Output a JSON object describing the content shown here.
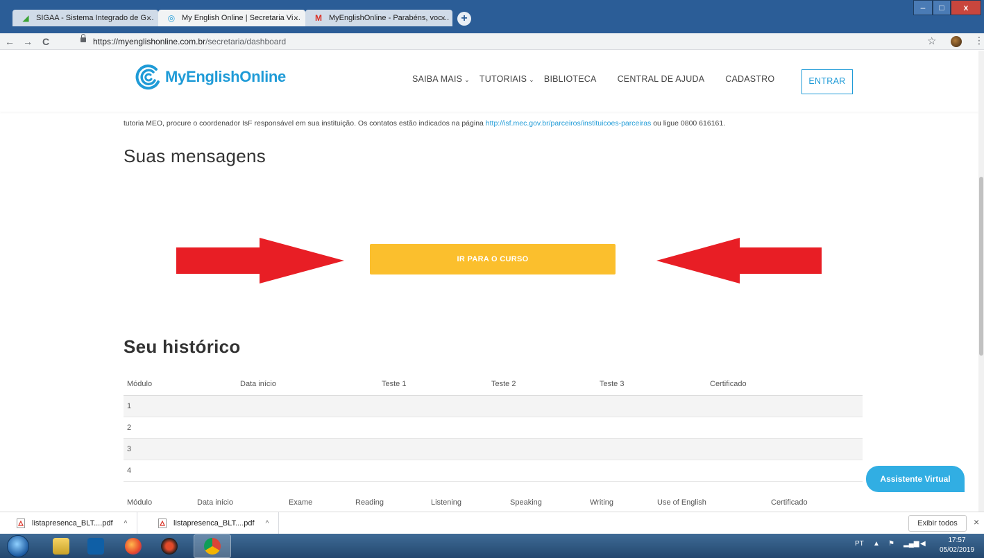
{
  "browser": {
    "tabs": [
      {
        "title": "SIGAA - Sistema Integrado de G…",
        "favicon": "sigaa-leaf-icon"
      },
      {
        "title": "My English Online | Secretaria Vi…",
        "favicon": "meo-logo-icon"
      },
      {
        "title": "MyEnglishOnline - Parabéns, voc…",
        "favicon": "gmail-icon"
      }
    ],
    "tab_close": "×",
    "new_tab": "+",
    "window_controls": {
      "minimize": "–",
      "maximize": "□",
      "close": "x"
    },
    "url_host": "https://myenglishonline.com.br",
    "url_path": "/secretaria/dashboard",
    "nav_back": "←",
    "nav_forward": "→",
    "nav_reload": "C",
    "bookmark_star": "☆",
    "menu_kebab": "⋮"
  },
  "site": {
    "logo_text": "MyEnglishOnline",
    "nav": [
      {
        "label": "SAIBA MAIS",
        "dropdown": true
      },
      {
        "label": "TUTORIAIS",
        "dropdown": true
      },
      {
        "label": "BIBLIOTECA",
        "dropdown": false
      },
      {
        "label": "CENTRAL DE AJUDA",
        "dropdown": false
      },
      {
        "label": "CADASTRO",
        "dropdown": false
      }
    ],
    "chevron": "⌄",
    "login_label": "ENTRAR",
    "accent_color": "#1f9bd7"
  },
  "intro": {
    "text_before": "tutoria MEO, procure o coordenador IsF responsável em sua instituição. Os contatos estão indicados na página ",
    "link": "http://isf.mec.gov.br/parceiros/instituicoes-parceiras",
    "text_after": " ou ligue 0800 616161."
  },
  "messages": {
    "title": "Suas mensagens",
    "course_button": "IR PARA O CURSO",
    "button_color": "#fbbf2d",
    "arrow_color": "#e81e25"
  },
  "history": {
    "title": "Seu histórico",
    "table1_headers": [
      "Módulo",
      "Data início",
      "Teste 1",
      "Teste 2",
      "Teste 3",
      "Certificado"
    ],
    "table1_rows": [
      "1",
      "2",
      "3",
      "4"
    ],
    "table2_headers": [
      "Módulo",
      "Data início",
      "Exame",
      "Reading",
      "Listening",
      "Speaking",
      "Writing",
      "Use of English",
      "Certificado"
    ]
  },
  "assistant_label": "Assistente Virtual",
  "downloads": {
    "items": [
      "listapresenca_BLT....pdf",
      "listapresenca_BLT....pdf"
    ],
    "expand": "^",
    "show_all": "Exibir todos",
    "close": "×"
  },
  "taskbar": {
    "language": "PT",
    "time": "17:57",
    "date": "05/02/2019"
  }
}
